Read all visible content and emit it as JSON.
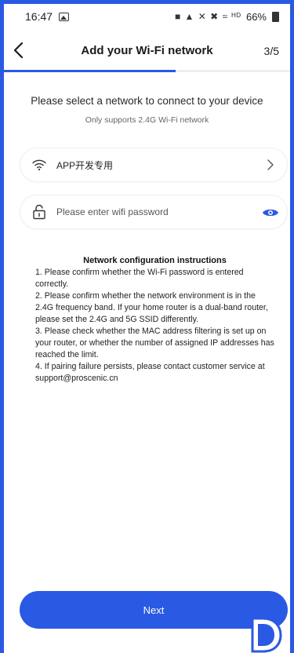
{
  "status_bar": {
    "time": "16:47",
    "indicators": "■ ▲ ✕ ✖ ≈ ᴴᴰ",
    "battery": "66%"
  },
  "header": {
    "title": "Add your Wi-Fi network",
    "step": "3/5",
    "progress": 0.6
  },
  "main": {
    "instruction": "Please select a network to connect to your device",
    "note": "Only supports 2.4G Wi-Fi network",
    "network_field": {
      "value": "APP开发专用",
      "icon": "wifi-icon"
    },
    "password_field": {
      "placeholder": "Please enter wifi password",
      "icon": "lock-icon",
      "toggle_icon": "eye-icon"
    }
  },
  "instructions": {
    "title": "Network configuration instructions",
    "items": [
      "1. Please confirm whether the Wi-Fi password is entered correctly.",
      "2. Please confirm whether the network environment is in the 2.4G frequency band. If your home router is a dual-band router, please set the 2.4G and 5G SSID differently.",
      "3. Please check whether the MAC address filtering is set up on your router, or whether the number of assigned IP addresses has reached the limit.",
      "4. If pairing failure persists, please contact customer service at support@proscenic.cn"
    ]
  },
  "footer": {
    "next_label": "Next"
  },
  "colors": {
    "accent": "#2a59e3",
    "background": "#ffffff",
    "field_border": "#eeeeee"
  }
}
